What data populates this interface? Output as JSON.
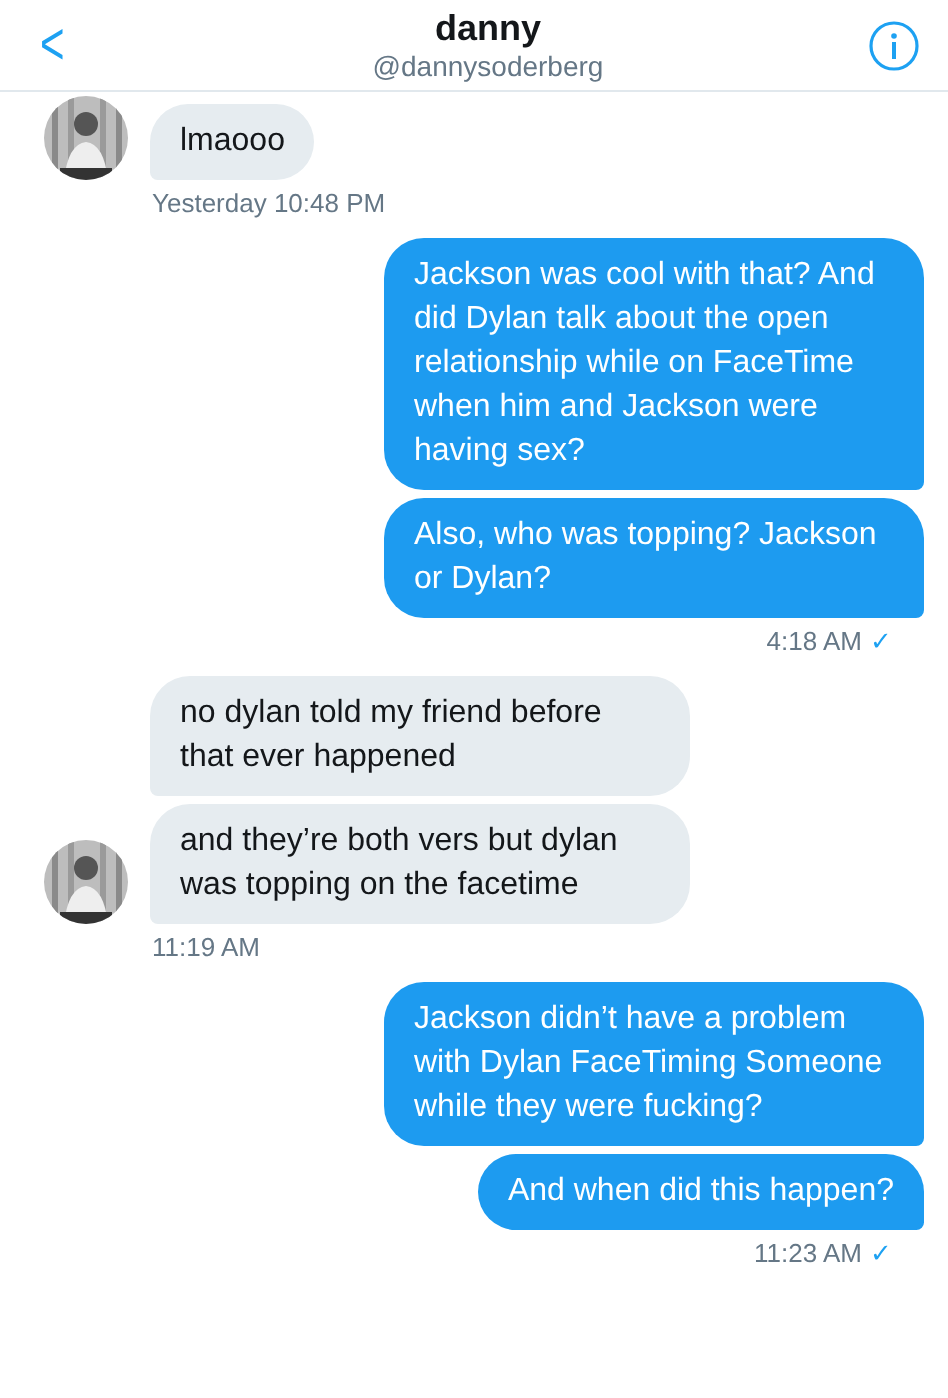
{
  "header": {
    "back": "<",
    "name": "danny",
    "handle": "@dannysoderberg"
  },
  "groups": [
    {
      "kind": "received",
      "bubbles": [
        "lmaooo"
      ],
      "time": "Yesterday 10:48 PM"
    },
    {
      "kind": "sent",
      "bubbles": [
        "Jackson was cool with that? And did Dylan talk about the open relationship while on FaceTime when him and Jackson were having sex?",
        "Also, who was topping? Jackson or Dylan?"
      ],
      "time": "4:18 AM",
      "receipt": "✓"
    },
    {
      "kind": "received",
      "bubbles": [
        "no dylan told my friend before that ever happened",
        "and they’re both vers but dylan was topping on the facetime"
      ],
      "time": "11:19 AM"
    },
    {
      "kind": "sent",
      "bubbles": [
        "Jackson didn’t have a problem with Dylan FaceTiming Someone while they were fucking?",
        "And when did this happen?"
      ],
      "time": "11:23 AM",
      "receipt": "✓"
    }
  ]
}
